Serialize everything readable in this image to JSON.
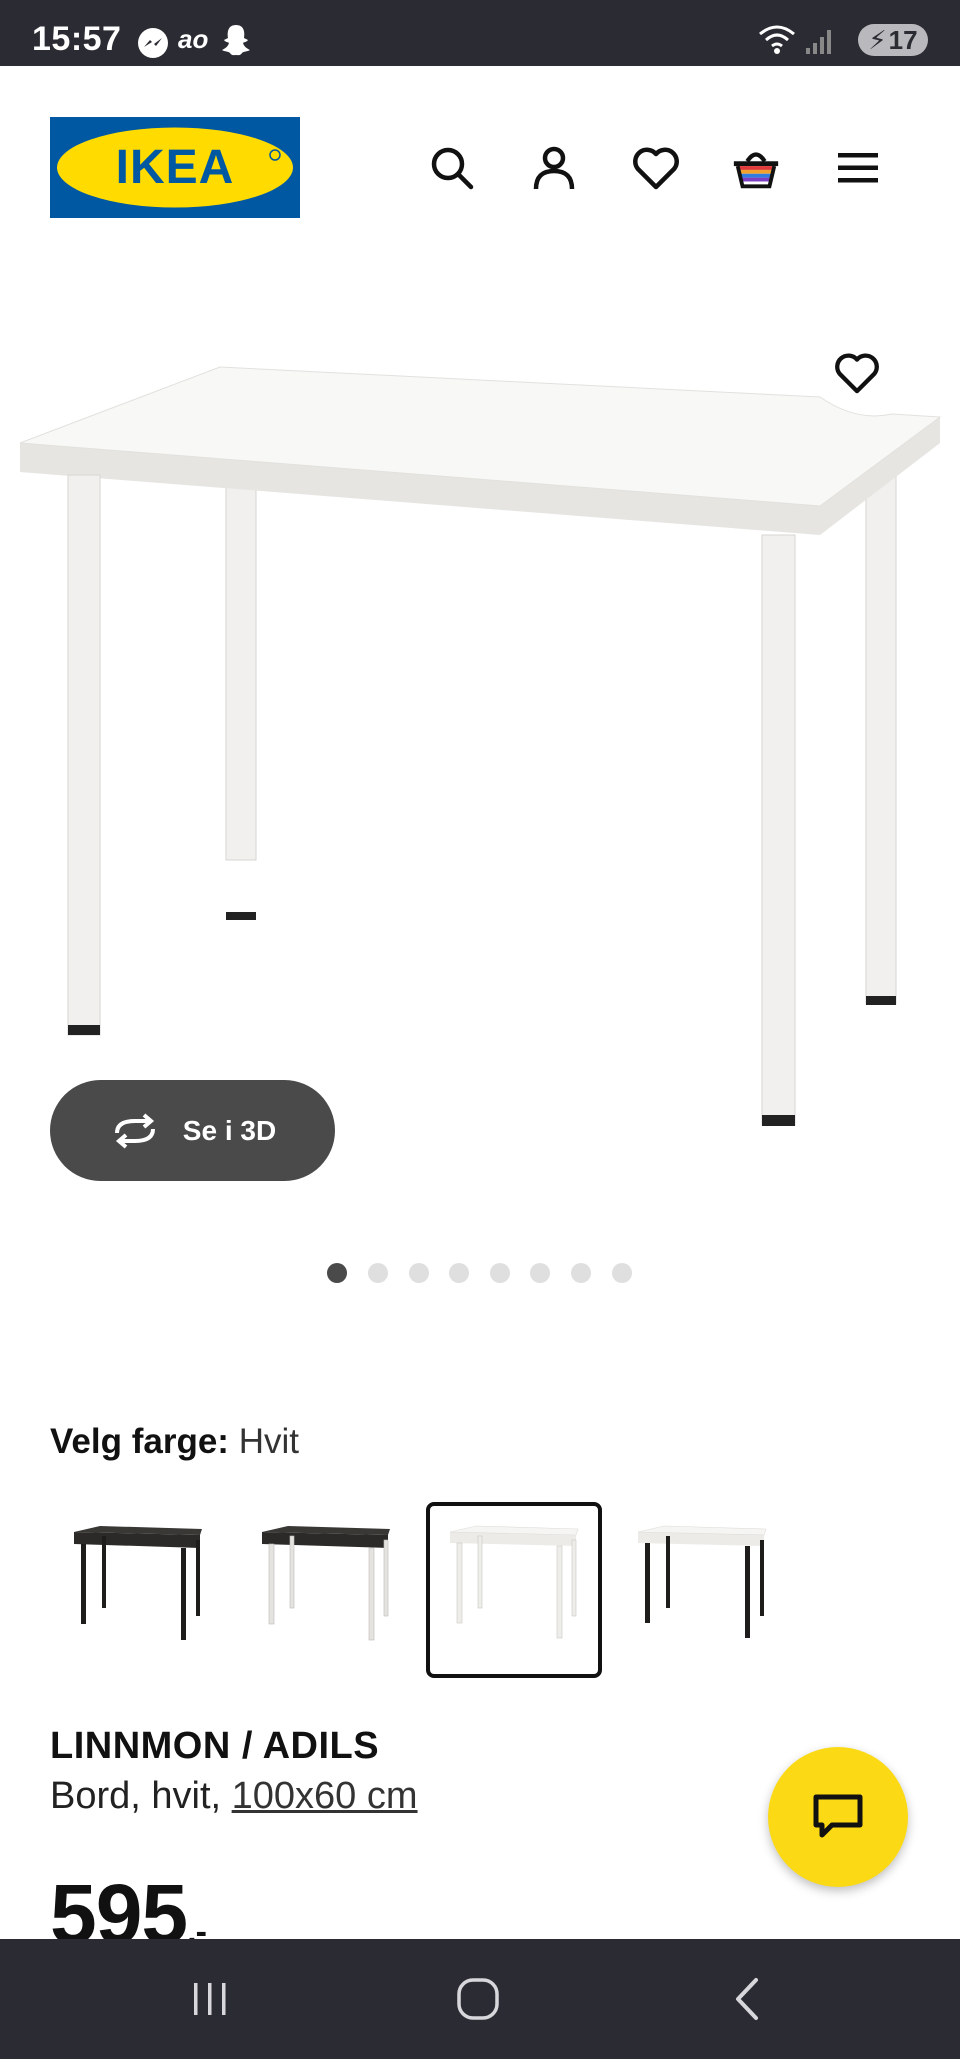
{
  "status_bar": {
    "time": "15:57",
    "app_text": "ao",
    "battery_level": "17"
  },
  "header": {
    "logo_text": "IKEA",
    "icons": [
      "search-icon",
      "user-icon",
      "heart-icon",
      "basket-icon",
      "menu-icon"
    ]
  },
  "gallery": {
    "button_3d_label": "Se i 3D",
    "image_count": 8,
    "active_index": 0
  },
  "color_picker": {
    "label_key": "Velg farge:",
    "label_value": "Hvit",
    "options": [
      "black-brown/black",
      "black-brown/white",
      "white/white",
      "white/black"
    ],
    "selected_index": 2
  },
  "product": {
    "name": "LINNMON / ADILS",
    "desc_prefix": "Bord, hvit, ",
    "size": "100x60 cm",
    "price": "595",
    "price_suffix": ",-"
  },
  "colors": {
    "ikea_blue": "#0058a3",
    "ikea_yellow": "#ffdb00",
    "chat_yellow": "#fbd914",
    "bar_dark": "#2b2b33"
  }
}
